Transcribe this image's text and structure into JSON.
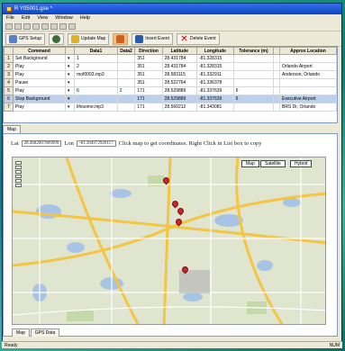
{
  "window": {
    "title": "R Y05001.gse *"
  },
  "menu": [
    "File",
    "Edit",
    "View",
    "Window",
    "Help"
  ],
  "toolbar": {
    "gps_setup": "GPS Setup",
    "update_map": "Update Map",
    "insert_event": "Insert Event",
    "delete_event": "Delete Event"
  },
  "grid": {
    "headers": [
      "",
      "Command",
      "",
      "Data1",
      "Data2",
      "Direction",
      "Latitude",
      "Longitude",
      "Tolerance (m)",
      "",
      "Approx Location"
    ],
    "rows": [
      [
        "1",
        "Set Background",
        "▾",
        "1",
        "",
        "351",
        "28.431784",
        "-81.328315",
        "",
        "",
        ""
      ],
      [
        "2",
        "Play",
        "▾",
        "2",
        "",
        "351",
        "28.431784",
        "-81.328315",
        "",
        "",
        "Orlando Airport"
      ],
      [
        "3",
        "Play",
        "▾",
        "mof0003.mp3",
        "",
        "351",
        "28.583115",
        "-81.332911",
        "",
        "",
        "Anderson, Orlando"
      ],
      [
        "4",
        "Pause",
        "▾",
        "",
        "",
        "351",
        "28.522764",
        "-81.336378",
        "",
        "",
        ""
      ],
      [
        "5",
        "Play",
        "▾",
        "6",
        "2",
        "171",
        "28.529889",
        "-81.337639",
        "6",
        "",
        ""
      ],
      [
        "6",
        "Stop Background",
        "▾",
        "",
        "",
        "171",
        "28.529889",
        "-81.337639",
        "6",
        "",
        "Executive Airport"
      ],
      [
        "7",
        "Play",
        "▾",
        "lifesome.mp3",
        "",
        "171",
        "28.560212",
        "-81.343081",
        "",
        "",
        "BRS Dr, Orlando"
      ]
    ]
  },
  "tabs": [
    "Map"
  ],
  "coords": {
    "lat_label": "Lat",
    "lat_value": "28.4682607809999",
    "lon_label": "Lon",
    "lon_value": "-81.304972920117",
    "hint": "Click map to get coordinates. Right Click in List box to copy"
  },
  "map": {
    "types": [
      "Map",
      "Satellite",
      "Hybrid"
    ]
  },
  "map_tabs": [
    "Map",
    "GPS Data"
  ],
  "status": {
    "left": "Ready",
    "right": "NUM"
  }
}
